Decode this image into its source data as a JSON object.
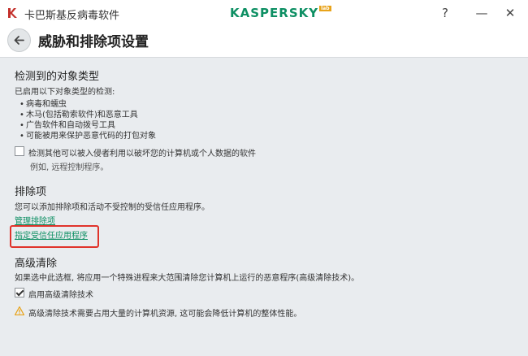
{
  "window": {
    "app_title": "卡巴斯基反病毒软件",
    "brand": "KASPERSKY",
    "brand_badge": "lab",
    "help": "?",
    "minimize": "—",
    "close": "✕"
  },
  "header": {
    "title": "威胁和排除项设置"
  },
  "detected": {
    "heading": "检测到的对象类型",
    "intro": "已启用以下对象类型的检测:",
    "items": [
      "病毒和蠕虫",
      "木马(包括勒索软件)和恶意工具",
      "广告软件和自动拨号工具",
      "可能被用来保护恶意代码的打包对象"
    ],
    "other_checkbox_label": "检测其他可以被入侵者利用以破坏您的计算机或个人数据的软件",
    "other_checked": false,
    "other_example": "例如, 远程控制程序。"
  },
  "exclusions": {
    "heading": "排除项",
    "description": "您可以添加排除项和活动不受控制的受信任应用程序。",
    "manage_link": "管理排除项",
    "trusted_link": "指定受信任应用程序"
  },
  "advanced": {
    "heading": "高级清除",
    "description": "如果选中此选框, 将应用一个特殊进程来大范围清除您计算机上运行的恶意程序(高级清除技术)。",
    "checkbox_label": "启用高级清除技术",
    "checked": true,
    "warning": "高级清除技术需要占用大量的计算机资源, 这可能会降低计算机的整体性能。"
  },
  "colors": {
    "accent": "#0d8f63",
    "highlight": "#e0332b",
    "warning": "#e8a31a"
  }
}
